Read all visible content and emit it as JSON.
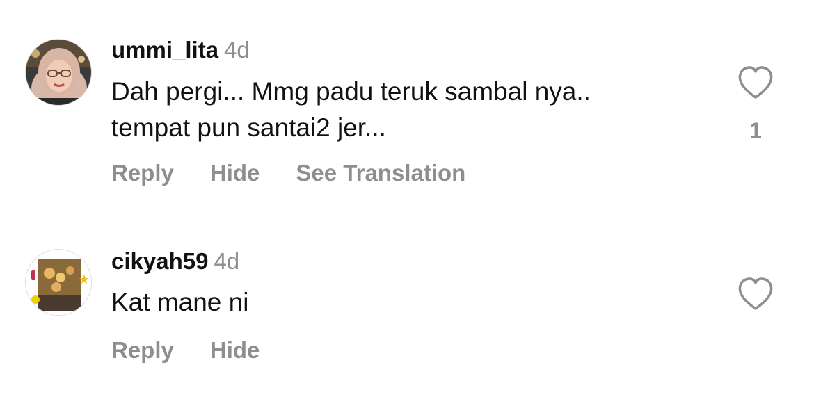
{
  "comments": [
    {
      "username": "ummi_lita",
      "time": "4d",
      "text": "Dah pergi... Mmg padu teruk sambal nya..\ntempat pun santai2 jer...",
      "actions": [
        "Reply",
        "Hide",
        "See Translation"
      ],
      "like_icon": "heart-outline-icon",
      "like_count": "1"
    },
    {
      "username": "cikyah59",
      "time": "4d",
      "text": "Kat mane ni",
      "actions": [
        "Reply",
        "Hide"
      ],
      "like_icon": "heart-outline-icon"
    }
  ],
  "colors": {
    "primary_text": "#111111",
    "secondary_text": "#8e8e8e",
    "background": "#ffffff"
  }
}
